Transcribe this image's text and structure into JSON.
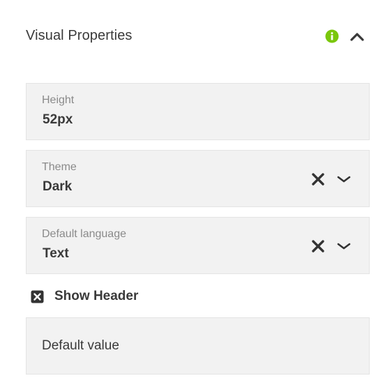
{
  "panel": {
    "title": "Visual Properties",
    "info_color": "#7ac70c"
  },
  "fields": {
    "height": {
      "label": "Height",
      "value": "52px"
    },
    "theme": {
      "label": "Theme",
      "value": "Dark"
    },
    "default_language": {
      "label": "Default language",
      "value": "Text"
    },
    "default_value": {
      "placeholder": "Default value"
    }
  },
  "show_header": {
    "label": "Show Header",
    "checked": true
  },
  "icons": {
    "info": "info-icon",
    "collapse": "chevron-up-icon",
    "clear": "close-icon",
    "dropdown": "chevron-down-icon",
    "checkbox": "checkbox-checked-icon"
  }
}
